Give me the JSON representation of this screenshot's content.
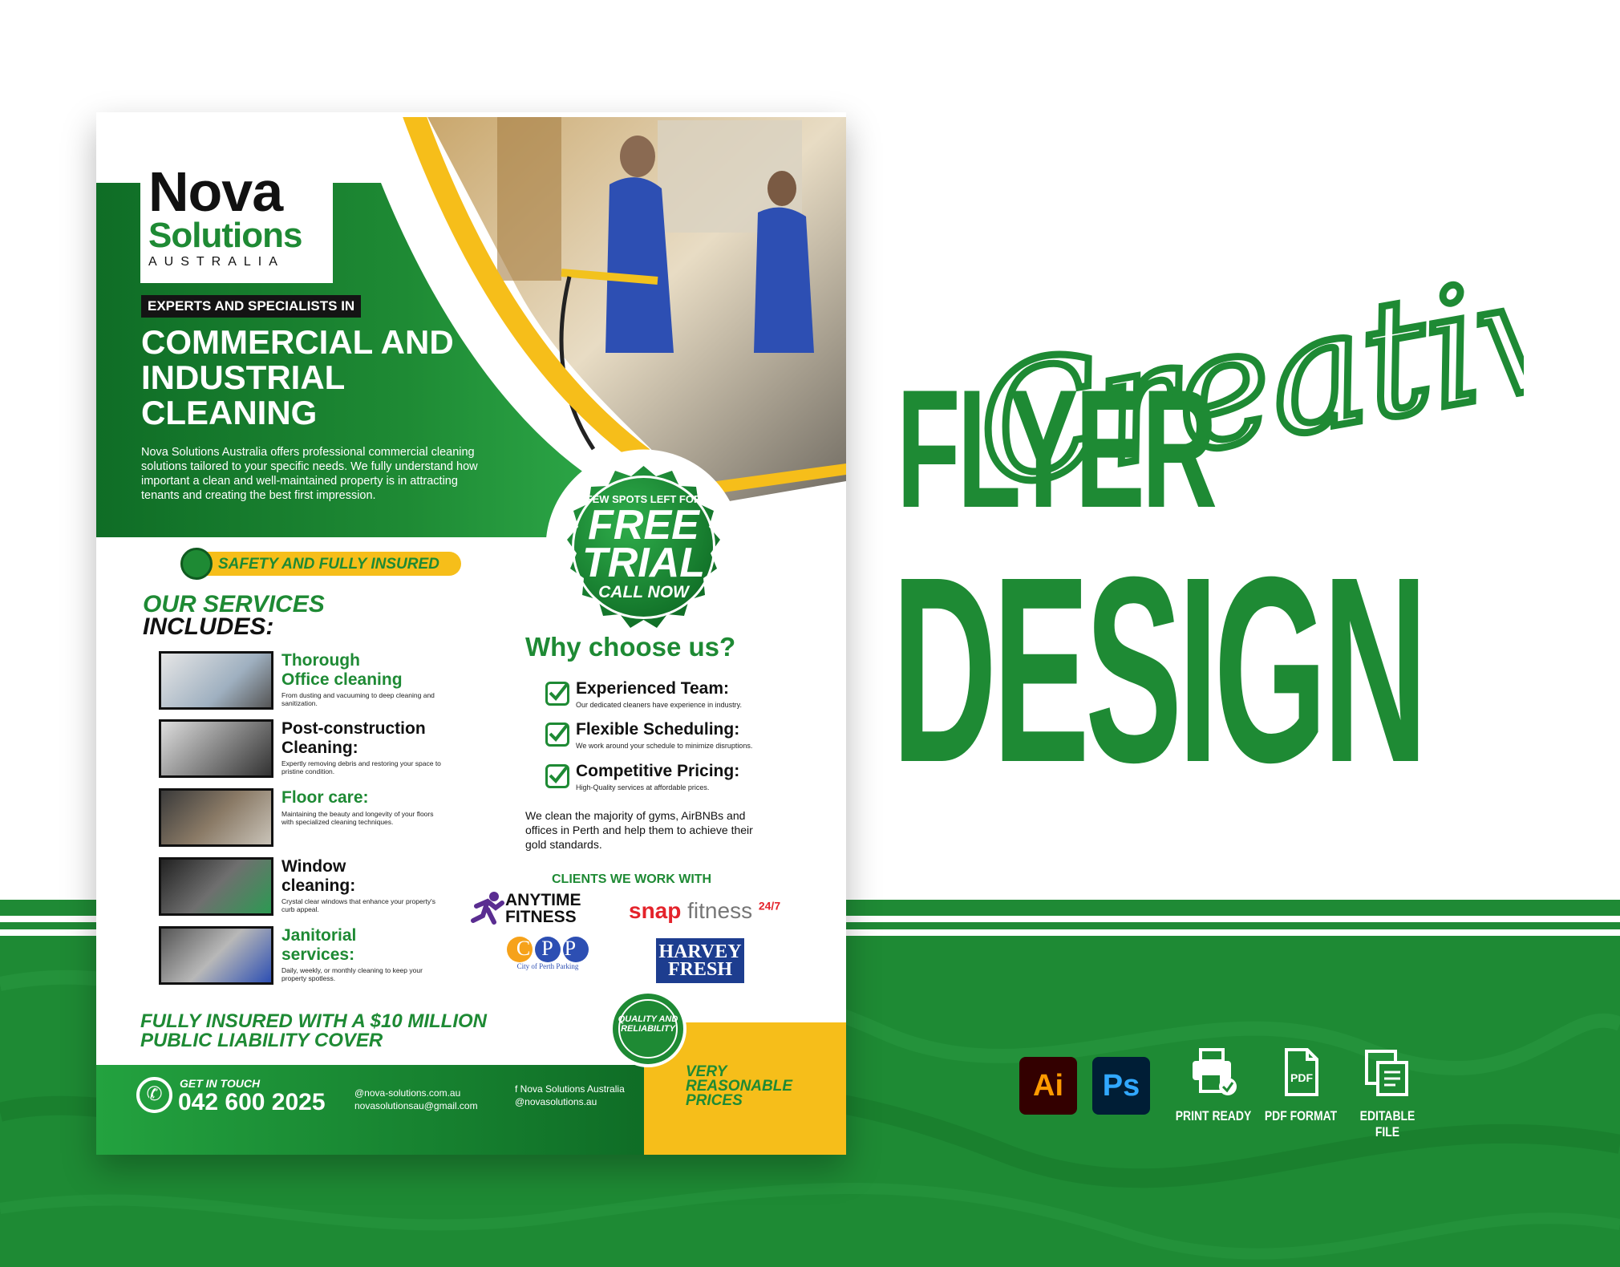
{
  "brand": {
    "name_line1": "Nova",
    "name_line2": "Solutions",
    "name_line3": "AUSTRALIA"
  },
  "flyer": {
    "tagline": "EXPERTS AND SPECIALISTS IN",
    "headline": "COMMERCIAL AND INDUSTRIAL CLEANING",
    "intro": "Nova Solutions Australia offers professional commercial cleaning solutions tailored to your specific needs. We fully understand how important a clean and well-maintained property is in attracting tenants and creating the best first impression.",
    "badge": {
      "top": "FEW SPOTS LEFT FOR",
      "free": "FREE",
      "trial": "TRIAL",
      "call": "CALL NOW"
    },
    "safety": "SAFETY AND FULLY INSURED",
    "services_title_1": "OUR SERVICES",
    "services_title_2": "INCLUDES:",
    "services": [
      {
        "name_1": "Thorough",
        "name_2": "Office cleaning",
        "desc": "From dusting and vacuuming to deep cleaning and sanitization."
      },
      {
        "name_1": "Post-construction",
        "name_2": "Cleaning:",
        "desc": "Expertly removing debris and restoring your space to pristine condition."
      },
      {
        "name_1": "Floor care:",
        "name_2": "",
        "desc": "Maintaining the beauty and longevity of your floors with specialized cleaning techniques."
      },
      {
        "name_1": "Window",
        "name_2": "cleaning:",
        "desc": "Crystal clear windows that enhance your property's curb appeal."
      },
      {
        "name_1": "Janitorial",
        "name_2": "services:",
        "desc": "Daily, weekly, or monthly cleaning to keep your property spotless."
      }
    ],
    "why_title": "Why choose us?",
    "reasons": [
      {
        "title": "Experienced Team:",
        "desc": "Our dedicated cleaners have experience in industry."
      },
      {
        "title": "Flexible Scheduling:",
        "desc": "We work around your schedule to minimize disruptions."
      },
      {
        "title": "Competitive Pricing:",
        "desc": "High-Quality services at affordable prices."
      }
    ],
    "blurb": "We clean the majority of gyms, AirBNBs and offices in Perth and help them to achieve their gold standards.",
    "clients_title": "CLIENTS WE WORK WITH",
    "clients": {
      "anytime_1": "ANYTIME",
      "anytime_2": "FITNESS",
      "snap_1": "snap",
      "snap_2": "fitness",
      "snap_3": "24/7",
      "cpp": "CPP",
      "cpp_sub": "City of Perth Parking",
      "harvey": "HARVEY FRESH"
    },
    "insured_1": "FULLY INSURED WITH A $10 MILLION",
    "insured_2": "PUBLIC LIABILITY COVER",
    "quality": "QUALITY AND RELIABILITY",
    "prices": "VERY REASONABLE PRICES",
    "footer": {
      "get_in_touch": "GET IN TOUCH",
      "phone": "042 600 2025",
      "website": "@nova-solutions.com.au",
      "email": "novasolutionsau@gmail.com",
      "facebook": "f Nova Solutions Australia",
      "instagram": "@novasolutions.au"
    }
  },
  "promo": {
    "script_word": "Creative",
    "word_1": "FLYER",
    "word_2": "DESIGN"
  },
  "software": {
    "ai": "Ai",
    "ps": "Ps"
  },
  "features": [
    {
      "label": "PRINT READY",
      "icon": "printer-icon"
    },
    {
      "label": "PDF FORMAT",
      "icon": "pdf-file-icon"
    },
    {
      "label": "EDITABLE FILE",
      "icon": "editable-file-icon"
    }
  ],
  "colors": {
    "brand_green": "#1e8a34",
    "accent_yellow": "#f6be1a",
    "dark": "#111111"
  }
}
